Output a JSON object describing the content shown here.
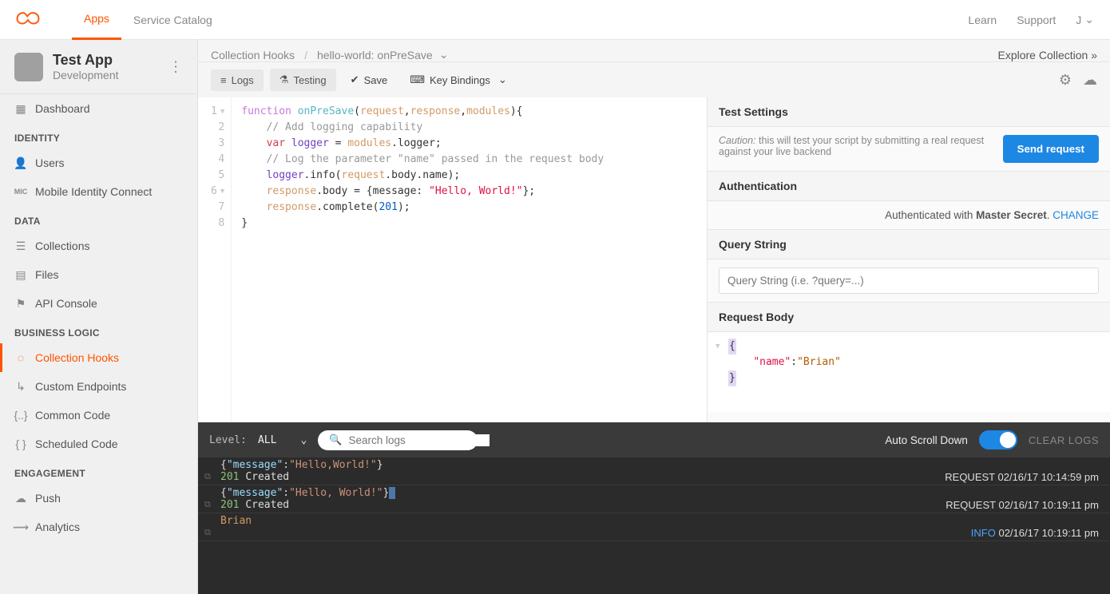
{
  "topnav": {
    "tabs": [
      "Apps",
      "Service Catalog"
    ],
    "right": {
      "learn": "Learn",
      "support": "Support",
      "user_initial": "J"
    }
  },
  "app": {
    "name": "Test App",
    "env": "Development"
  },
  "sidebar": {
    "dashboard": "Dashboard",
    "sections": {
      "identity": {
        "label": "IDENTITY",
        "items": [
          "Users",
          "Mobile Identity Connect"
        ],
        "mic_badge": "MIC"
      },
      "data": {
        "label": "DATA",
        "items": [
          "Collections",
          "Files",
          "API Console"
        ]
      },
      "bl": {
        "label": "BUSINESS LOGIC",
        "items": [
          "Collection Hooks",
          "Custom Endpoints",
          "Common Code",
          "Scheduled Code"
        ]
      },
      "eng": {
        "label": "ENGAGEMENT",
        "items": [
          "Push",
          "Analytics"
        ]
      }
    }
  },
  "breadcrumb": {
    "a": "Collection Hooks",
    "b": "hello-world: onPreSave",
    "explore": "Explore Collection »"
  },
  "toolbar": {
    "logs": "Logs",
    "testing": "Testing",
    "save": "Save",
    "keybind": "Key Bindings"
  },
  "code": {
    "lines": 8,
    "l1": {
      "kw": "function",
      "name": "onPreSave",
      "p1": "request",
      "p2": "response",
      "p3": "modules",
      "tail": "){"
    },
    "l2": "// Add logging capability",
    "l3": {
      "kw": "var",
      "id": "logger",
      "rhs1": "modules",
      "rhs2": ".logger;"
    },
    "l4": "// Log the parameter \"name\" passed in the request body",
    "l5": {
      "a": "logger",
      "b": ".info(",
      "c": "request",
      "d": ".body.name);"
    },
    "l6": {
      "a": "response",
      "b": ".body = {message: ",
      "s": "\"Hello, World!\"",
      "c": "};"
    },
    "l7": {
      "a": "response",
      "b": ".complete(",
      "n": "201",
      "c": ");"
    },
    "l8": "}"
  },
  "test": {
    "settings_h": "Test Settings",
    "caution_label": "Caution:",
    "caution_text": " this will test your script by submitting a real request against your live backend",
    "send": "Send request",
    "auth_h": "Authentication",
    "auth_text": "Authenticated with ",
    "auth_method": "Master Secret",
    "auth_change": "CHANGE",
    "qs_h": "Query String",
    "qs_ph": "Query String (i.e. ?query=...)",
    "body_h": "Request Body",
    "json": {
      "k": "\"name\"",
      "v": "\"Brian\""
    }
  },
  "logs": {
    "level_lbl": "Level:",
    "level_val": "ALL",
    "search_ph": "Search logs",
    "auto": "Auto Scroll Down",
    "clear": "CLEAR LOGS",
    "entries": [
      {
        "msg_k": "\"message\"",
        "msg_v": "\"Hello,World!\"",
        "code": "201",
        "status": "Created",
        "type": "REQUEST",
        "ts": "02/16/17 10:14:59 pm"
      },
      {
        "msg_k": "\"message\"",
        "msg_v": "\"Hello, World!\"",
        "code": "201",
        "status": "Created",
        "type": "REQUEST",
        "ts": "02/16/17 10:19:11 pm"
      },
      {
        "plain": "Brian",
        "type": "INFO",
        "ts": "02/16/17 10:19:11 pm"
      }
    ]
  }
}
